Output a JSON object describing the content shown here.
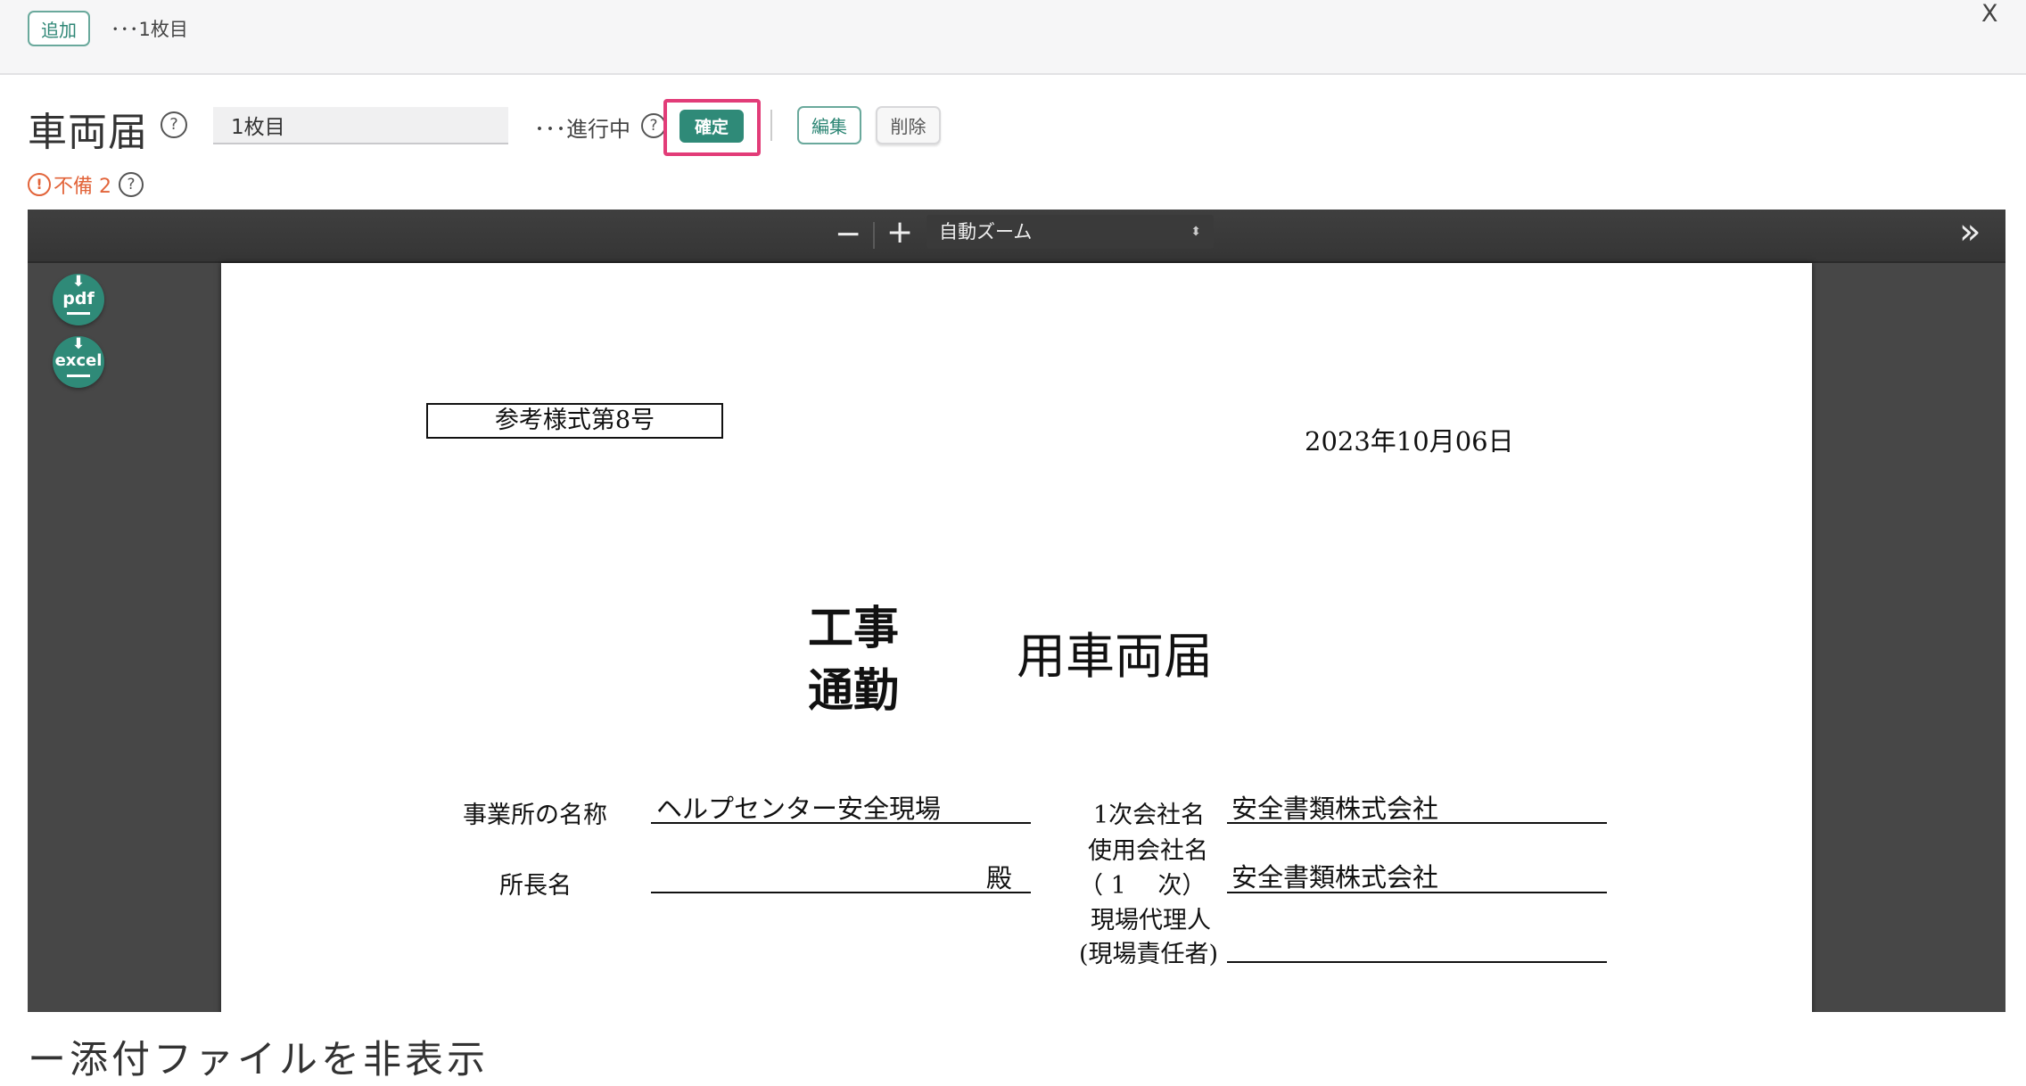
{
  "topbar": {
    "add_label": "追加",
    "sheet_label": "･･･1枚目",
    "close_label": "X"
  },
  "header": {
    "title": "車両届",
    "help": "?",
    "sheet_value": "1枚目",
    "status": "･･･進行中",
    "confirm_label": "確定",
    "edit_label": "編集",
    "delete_label": "削除"
  },
  "warning": {
    "icon": "!",
    "text": "不備 2"
  },
  "viewer": {
    "zoom_out": "−",
    "zoom_in": "+",
    "zoom_value": "自動ズーム",
    "zoom_arrow": "⬍",
    "sidebar_toggle": "»",
    "pdf_label": "pdf",
    "excel_label": "excel"
  },
  "document": {
    "form_number": "参考様式第8号",
    "date": "2023年10月06日",
    "kind_1": "工事",
    "kind_2": "通勤",
    "title": "用車両届",
    "office_label": "事業所の名称",
    "office_value": "ヘルプセンター安全現場",
    "manager_label": "所長名",
    "manager_suffix": "殿",
    "primary_company_label": "1次会社名",
    "primary_company_value": "安全書類株式会社",
    "user_company_label": "使用会社名",
    "user_company_tier": "（ 1　 次）",
    "user_company_value": "安全書類株式会社",
    "agent_label_1": "現場代理人",
    "agent_label_2": "(現場責任者)"
  },
  "attachments": {
    "toggle_label": "ー添付ファイルを非表示"
  },
  "colors": {
    "accent": "#2f8a78",
    "highlight": "#e23c78",
    "warning": "#e2643a",
    "viewer_bg": "#474747"
  }
}
